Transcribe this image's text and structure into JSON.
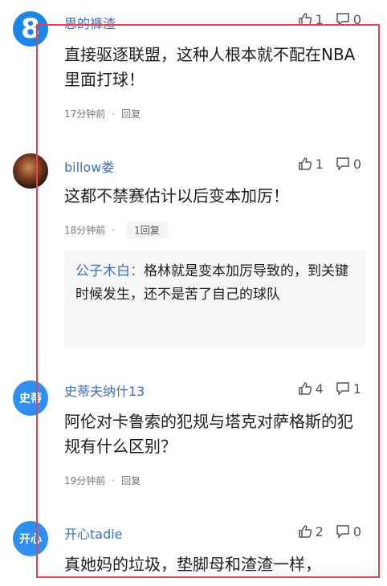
{
  "comments": [
    {
      "username": "思的褲渣",
      "avatar_text": "8",
      "likes": "1",
      "replies": "0",
      "text": "直接驱逐联盟，这种人根本就不配在NBA里面打球！",
      "time": "17分钟前",
      "reply_label": "回复"
    },
    {
      "username": "billow娄",
      "likes": "1",
      "replies": "0",
      "text": "这都不禁赛估计以后变本加厉！",
      "time": "18分钟前",
      "reply_label": "1回复",
      "quote": {
        "name": "公子木白：",
        "text": "格林就是变本加厉导致的，到关键时候发生，还不是苦了自己的球队"
      }
    },
    {
      "username": "史蒂夫纳什13",
      "avatar_text": "史蒂",
      "likes": "4",
      "replies": "1",
      "text": "阿伦对卡鲁索的犯规与塔克对萨格斯的犯规有什么区别？",
      "time": "19分钟前",
      "reply_label": "回复"
    },
    {
      "username": "开心tadie",
      "avatar_text": "开心",
      "likes": "2",
      "replies": "0",
      "text": "真她妈的垃圾，垫脚母和渣渣一样，"
    }
  ],
  "dot": "·",
  "icons": {
    "like": "thumbs-up-icon",
    "reply": "comment-bubble-icon"
  },
  "colors": {
    "username": "#3f6fb8",
    "frame": "#e3424f",
    "avatar_blue": "#2e8ff0"
  }
}
